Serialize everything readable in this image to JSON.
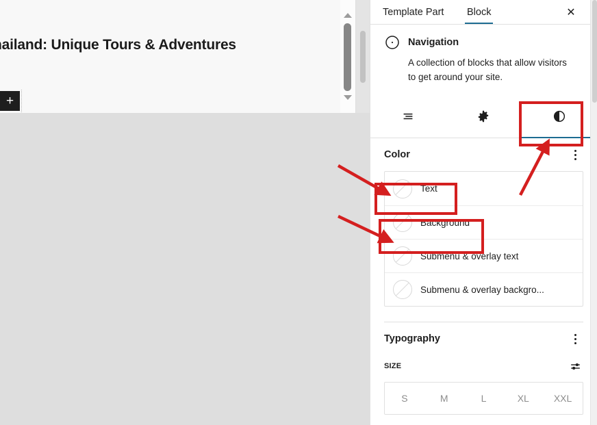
{
  "editor": {
    "heading": "hailand: Unique Tours & Adventures",
    "add_block_label": "+",
    "add_block_icon": "plus-icon",
    "scrollbar_up_icon": "triangle-up-icon",
    "scrollbar_down_icon": "triangle-down-icon"
  },
  "sidebar": {
    "tabs": [
      {
        "label": "Template Part",
        "active": false
      },
      {
        "label": "Block",
        "active": true
      }
    ],
    "close_icon": "close-icon",
    "close_label": "✕",
    "block": {
      "icon": "navigation-compass-icon",
      "title": "Navigation",
      "description": "A collection of blocks that allow visitors to get around your site."
    },
    "panel_tabs": [
      {
        "name": "list-view-icon",
        "label": "List view",
        "active": false
      },
      {
        "name": "settings-gear-icon",
        "label": "Settings",
        "active": false
      },
      {
        "name": "styles-half-circle-icon",
        "label": "Styles",
        "active": true
      }
    ],
    "color": {
      "heading": "Color",
      "kebab_icon": "kebab-menu-icon",
      "rows": [
        {
          "label": "Text",
          "swatch": "no-color-swatch"
        },
        {
          "label": "Background",
          "swatch": "no-color-swatch"
        },
        {
          "label": "Submenu & overlay text",
          "swatch": "no-color-swatch"
        },
        {
          "label": "Submenu & overlay backgro...",
          "swatch": "no-color-swatch"
        }
      ]
    },
    "typography": {
      "heading": "Typography",
      "kebab_icon": "kebab-menu-icon",
      "size_label": "SIZE",
      "size_options_icon": "sliders-icon",
      "sizes": [
        {
          "label": "S"
        },
        {
          "label": "M"
        },
        {
          "label": "L"
        },
        {
          "label": "XL"
        },
        {
          "label": "XXL"
        }
      ]
    }
  },
  "annotations": {
    "color": "#d41f1f",
    "boxes": [
      {
        "name": "styles-tab-highlight"
      },
      {
        "name": "text-color-highlight"
      },
      {
        "name": "background-color-highlight"
      }
    ],
    "arrows": [
      {
        "name": "arrow-to-styles-tab"
      },
      {
        "name": "arrow-to-text-color"
      },
      {
        "name": "arrow-to-background-color"
      }
    ]
  },
  "theme": {
    "accent": "#1d6c92",
    "canvas_bg": "#f8f8f8",
    "page_bg": "#dedede",
    "sidebar_bg": "#ffffff",
    "border": "#e0e0e0",
    "text": "#1e1e1e",
    "muted_text": "#8d8d8d"
  }
}
